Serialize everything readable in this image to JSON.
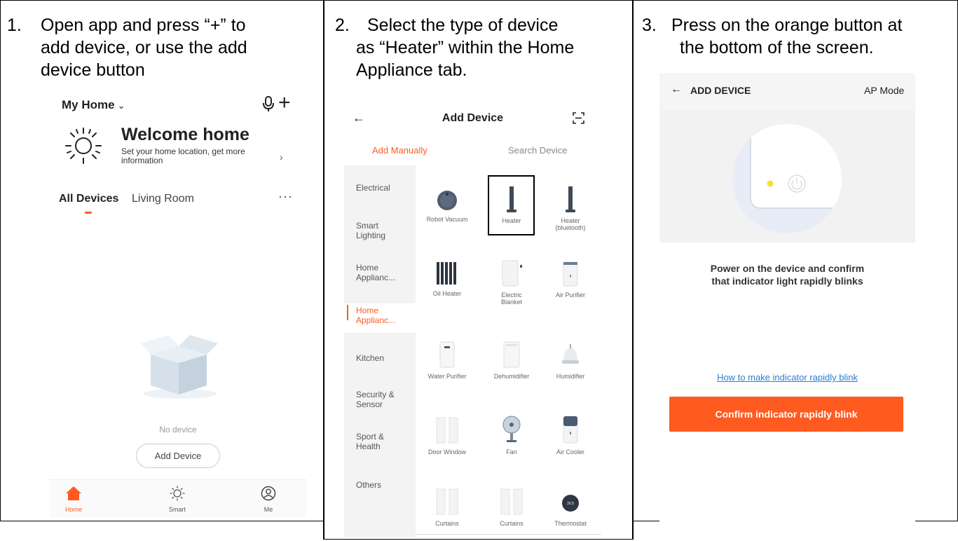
{
  "steps": [
    {
      "number": "1.",
      "lines": [
        "Open app and press “+” to",
        "add device, or use the add",
        "device button"
      ]
    },
    {
      "number": "2.",
      "lines": [
        "Select the type of device",
        "as “Heater” within the Home",
        "Appliance tab."
      ]
    },
    {
      "number": "3.",
      "lines": [
        "Press on the orange button at",
        "the bottom of the screen."
      ]
    }
  ],
  "screen1": {
    "home_title": "My Home",
    "welcome_title": "Welcome home",
    "welcome_sub": "Set your home location, get more information",
    "tabs": [
      "All Devices",
      "Living Room"
    ],
    "more": "···",
    "no_device": "No device",
    "add_device": "Add Device",
    "nav": [
      "Home",
      "Smart",
      "Me"
    ],
    "accent": "#ff5a1f",
    "icons": [
      "chevron-down-icon",
      "microphone-icon",
      "plus-icon",
      "sun-icon",
      "chevron-right-icon",
      "empty-box-icon",
      "home-icon",
      "smart-icon",
      "profile-icon"
    ]
  },
  "screen2": {
    "title": "Add Device",
    "tabs": [
      "Add Manually",
      "Search Device"
    ],
    "sidebar": [
      "Electrical",
      "Smart Lighting",
      "Home Applianc...",
      "Home Applianc...",
      "Kitchen",
      "Security & Sensor",
      "Sport & Health",
      "Others"
    ],
    "devices": [
      {
        "label": "Robot Vacuum",
        "icon": "robot-vacuum-icon"
      },
      {
        "label": "Heater",
        "icon": "heater-icon"
      },
      {
        "label": "Heater (bluetooth)",
        "icon": "heater-icon"
      },
      {
        "label": "Oil Heater",
        "icon": "oil-heater-icon"
      },
      {
        "label": "Electric Blanket",
        "icon": "electric-blanket-icon"
      },
      {
        "label": "Air Purifier",
        "icon": "air-purifier-icon"
      },
      {
        "label": "Water Purifier",
        "icon": "water-purifier-icon"
      },
      {
        "label": "Dehumidifier",
        "icon": "dehumidifier-icon"
      },
      {
        "label": "Humidifier",
        "icon": "humidifier-icon"
      },
      {
        "label": "Door Window",
        "icon": "door-window-icon"
      },
      {
        "label": "Fan",
        "icon": "fan-icon"
      },
      {
        "label": "Air Cooler",
        "icon": "air-cooler-icon"
      },
      {
        "label": "Curtains",
        "icon": "curtains-icon"
      },
      {
        "label": "Curtains",
        "icon": "curtains-icon"
      },
      {
        "label": "Thermostat",
        "icon": "thermostat-icon"
      }
    ],
    "thermostat_value": "20.5",
    "icons": [
      "back-arrow-icon",
      "scan-icon"
    ]
  },
  "screen3": {
    "title": "ADD DEVICE",
    "mode": "AP Mode",
    "message_lines": [
      "Power on the device and confirm",
      "that indicator light rapidly blinks"
    ],
    "help_link": "How to make indicator rapidly blink",
    "confirm_button": "Confirm indicator rapidly blink",
    "icons": [
      "back-arrow-icon",
      "power-icon",
      "indicator-light-icon"
    ]
  }
}
